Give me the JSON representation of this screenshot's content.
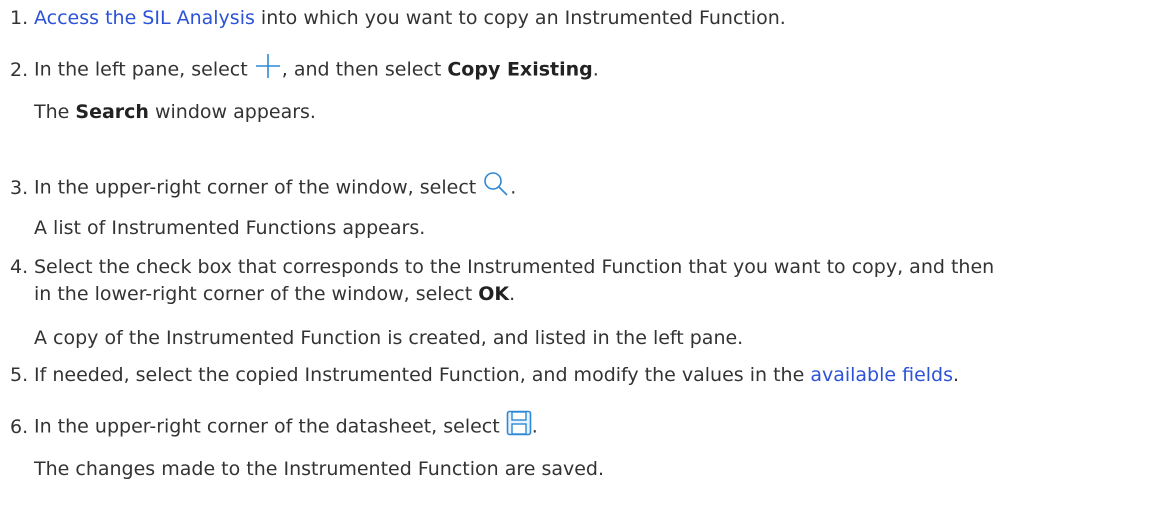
{
  "steps": [
    {
      "num": "1.",
      "link": "Access the SIL Analysis",
      "text_after": " into which you want to copy an Instrumented Function."
    },
    {
      "num": "2.",
      "text_before": "In the left pane, select ",
      "icon": "plus-icon",
      "text_middle": ", and then select ",
      "bold": "Copy Existing",
      "text_after": ".",
      "result_before": "The ",
      "result_bold": "Search",
      "result_after": " window appears."
    },
    {
      "num": "3.",
      "text_before": "In the upper-right corner of the window, select ",
      "icon": "search-icon",
      "text_after": ".",
      "result": "A list of Instrumented Functions appears."
    },
    {
      "num": "4.",
      "line1": "Select the check box that corresponds to the Instrumented Function that you want to copy, and then",
      "line2_before": "in the lower-right corner of the window, select ",
      "bold": "OK",
      "text_after": ".",
      "result": "A copy of the Instrumented Function is created, and listed in the left pane."
    },
    {
      "num": "5.",
      "text_before": "If needed, select the copied Instrumented Function, and modify the values in the ",
      "link": "available fields",
      "text_after": "."
    },
    {
      "num": "6.",
      "text_before": "In the upper-right corner of the datasheet, select ",
      "icon": "save-icon",
      "text_after": ".",
      "result": "The changes made to the Instrumented Function are saved."
    }
  ],
  "colors": {
    "link": "#2b52d8",
    "icon": "#2f88d6",
    "text": "#333333"
  }
}
